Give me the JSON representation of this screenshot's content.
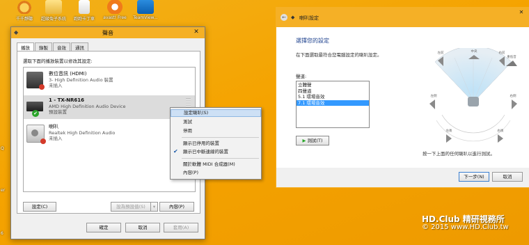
{
  "desktop": {
    "icons": [
      {
        "label": "千千靜聽"
      },
      {
        "label": "超級兔子系統"
      },
      {
        "label": "跑跑卡丁車"
      },
      {
        "label": "avast! Free"
      },
      {
        "label": "TeamView..."
      }
    ],
    "edge_labels": [
      "Q",
      "er",
      "6"
    ]
  },
  "sound_dialog": {
    "title": "聲音",
    "close_glyph": "✕",
    "tabs": [
      "播放",
      "錄製",
      "音效",
      "通訊"
    ],
    "instruction": "選取下面的播放裝置以修改其設定:",
    "devices": [
      {
        "name": "數位音訊 (HDMI)",
        "driver": "3- High Definition Audio 裝置",
        "status": "未插入"
      },
      {
        "name": "1 - TX-NR616",
        "driver": "AMD High Definition Audio Device",
        "status": "預設裝置"
      },
      {
        "name": "喇叭",
        "driver": "Realtek High Definition Audio",
        "status": "未插入"
      }
    ],
    "buttons": {
      "configure": "設定(C)",
      "set_default": "設為預設值(S)",
      "dropdown_glyph": "▾",
      "properties": "內容(P)",
      "ok": "確定",
      "cancel": "取消",
      "apply": "套用(A)"
    }
  },
  "context_menu": {
    "items": [
      {
        "label": "設定喇叭(S)",
        "checked": false,
        "hover": true
      },
      {
        "label": "測試",
        "checked": false
      },
      {
        "label": "停用",
        "checked": false
      },
      {
        "label": "顯示已停用的裝置",
        "checked": false
      },
      {
        "label": "顯示已中斷連線的裝置",
        "checked": true
      },
      {
        "label": "關於軟體 MIDI 合成器(M)",
        "checked": false
      },
      {
        "label": "內容(P)",
        "checked": false
      }
    ],
    "check_glyph": "✔"
  },
  "speaker_wizard": {
    "title": "喇叭設定",
    "back_glyph": "←",
    "close_glyph": "✕",
    "heading": "選擇您的設定",
    "description": "在下面選取最符合您電腦設定的喇叭設定。",
    "channels_label": "聲道:",
    "channels": [
      "立體聲",
      "四聲道",
      "5.1 環場音效",
      "7.1 環場音效"
    ],
    "selected_channel": "7.1 環場音效",
    "test_button": "測試(T)",
    "test_glyph": "▶",
    "hint": "按一下上面的任何喇叭以進行測試。",
    "next_button": "下一步(N)",
    "cancel_button": "取消",
    "speakers": [
      "左前",
      "中央",
      "右前",
      "重低音",
      "左側",
      "右側",
      "左後",
      "右後"
    ]
  },
  "watermark": {
    "line1": "HD.Club 精研視務所",
    "line2": "© 2015  www.HD.Club.tw"
  },
  "colors": {
    "accent": "#f5b026",
    "desktop": "#f5a300",
    "selection": "#3399ff",
    "default_check": "#2aa52a"
  }
}
